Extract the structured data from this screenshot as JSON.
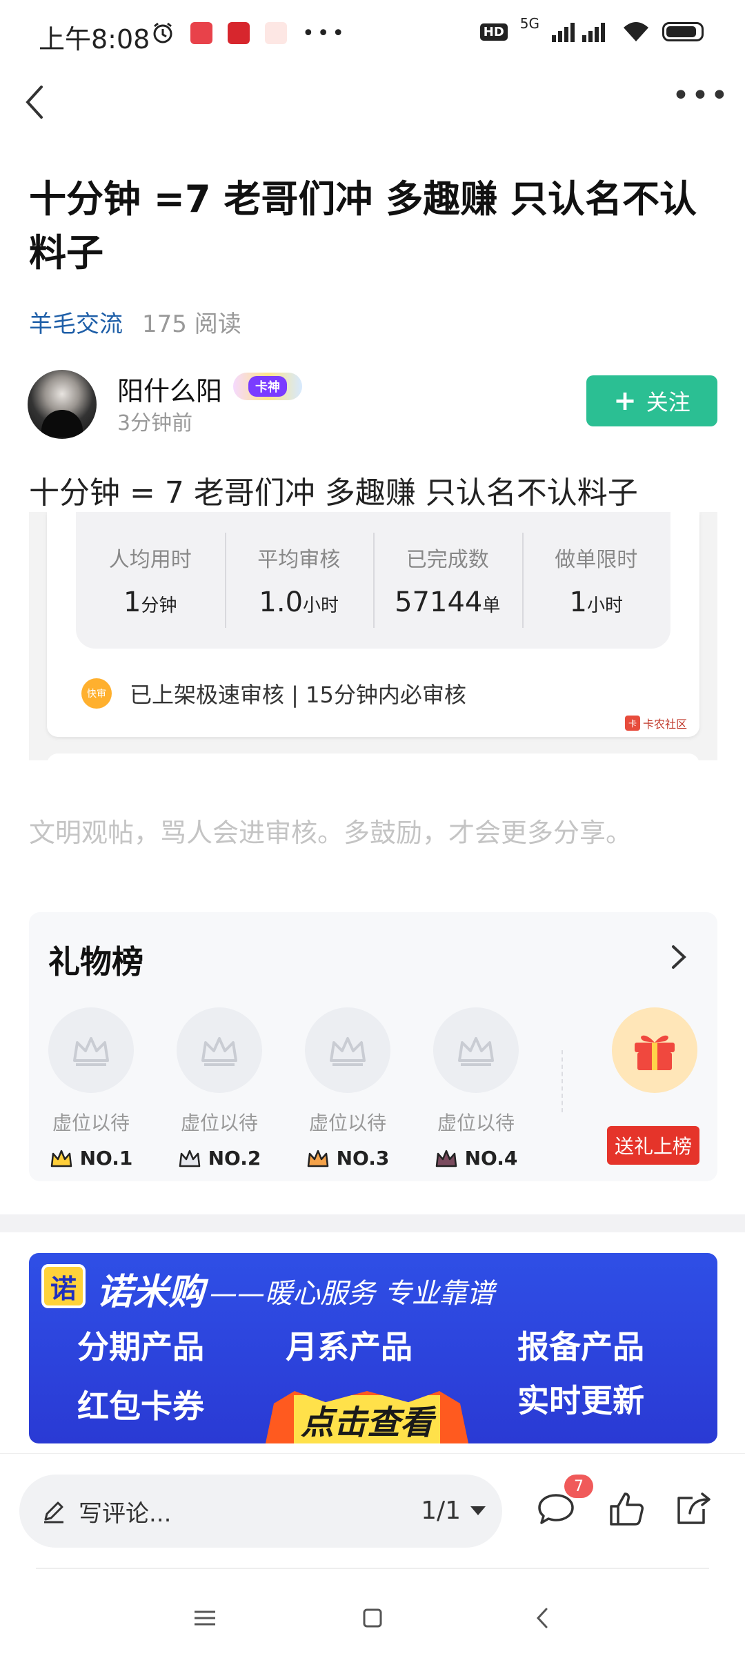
{
  "status_bar": {
    "time": "上午8:08",
    "network": "5G",
    "hd": "HD"
  },
  "post": {
    "title": "十分钟 =7 老哥们冲 多趣赚 只认名不认料子",
    "category": "羊毛交流",
    "read_count": "175 阅读",
    "author_name": "阳什么阳",
    "author_badge": "卡神",
    "time_ago": "3分钟前",
    "follow_label": "关注",
    "body": "十分钟 = 7 老哥们冲 多趣赚 只认名不认料子"
  },
  "embed": {
    "stats": [
      {
        "label": "人均用时",
        "value": "1",
        "unit": "分钟"
      },
      {
        "label": "平均审核",
        "value": "1.0",
        "unit": "小时"
      },
      {
        "label": "已完成数",
        "value": "57144",
        "unit": "单"
      },
      {
        "label": "做单限时",
        "value": "1",
        "unit": "小时"
      }
    ],
    "fast_icon_text": "快审",
    "fast_review_text": "已上架极速审核 | 15分钟内必审核",
    "watermark": "卡农社区"
  },
  "civility_notice": "文明观帖，骂人会进审核。多鼓励，才会更多分享。",
  "gift_board": {
    "title": "礼物榜",
    "slots": [
      {
        "label": "虚位以待",
        "rank": "NO.1"
      },
      {
        "label": "虚位以待",
        "rank": "NO.2"
      },
      {
        "label": "虚位以待",
        "rank": "NO.3"
      },
      {
        "label": "虚位以待",
        "rank": "NO.4"
      }
    ],
    "send_label": "送礼上榜"
  },
  "ad": {
    "logo_char": "诺",
    "brand": "诺米购",
    "tagline": "——暖心服务 专业靠谱",
    "items": [
      "分期产品",
      "月系产品",
      "报备产品",
      "红包卡券",
      "实时更新"
    ],
    "cta": "点击查看"
  },
  "bottom_bar": {
    "comment_placeholder": "写评论...",
    "page": "1/1",
    "comment_count": "7"
  },
  "colors": {
    "accent_green": "#2bbf93",
    "link_blue": "#1f5fa8",
    "ad_blue": "#2f4fe6",
    "gift_red": "#e5342a"
  }
}
